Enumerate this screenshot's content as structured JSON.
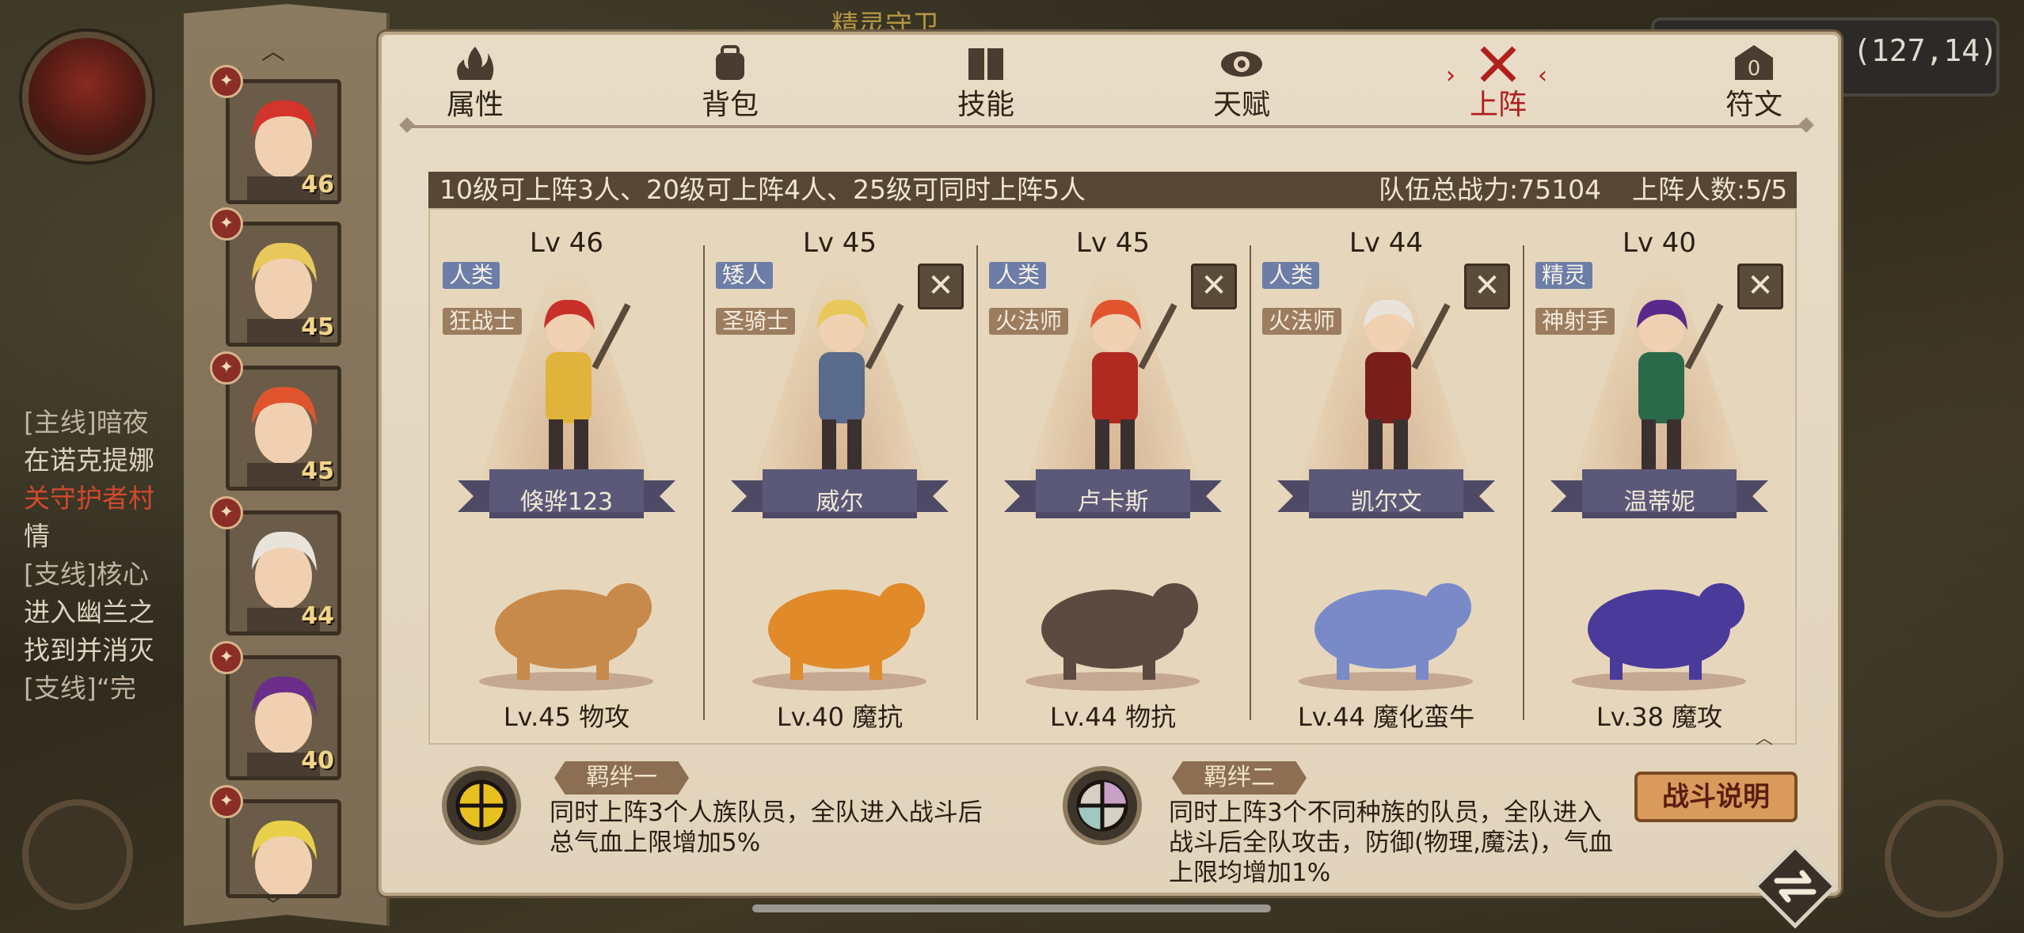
{
  "world": {
    "top_title": "精灵守卫",
    "coordinates": "(127,14)"
  },
  "quest_log": {
    "lines": [
      {
        "text": "[主线]暗夜",
        "style": "hdr"
      },
      {
        "text": "在诺克提娜",
        "style": ""
      },
      {
        "text": "关守护者村",
        "style": "red"
      },
      {
        "text": "情",
        "style": ""
      },
      {
        "text": "[支线]核心",
        "style": "hdr"
      },
      {
        "text": "进入幽兰之",
        "style": ""
      },
      {
        "text": "找到并消灭",
        "style": ""
      },
      {
        "text": "[支线]“完",
        "style": "hdr"
      }
    ]
  },
  "roster": [
    {
      "level": "46",
      "hair": "#d4352a"
    },
    {
      "level": "45",
      "hair": "#e8c85a"
    },
    {
      "level": "45",
      "hair": "#e0552e"
    },
    {
      "level": "44",
      "hair": "#e8e4dc"
    },
    {
      "level": "40",
      "hair": "#6a2e8a"
    },
    {
      "level": "",
      "hair": "#e8d04a"
    }
  ],
  "tabs": [
    {
      "label": "属性",
      "icon": "flame-icon",
      "active": false
    },
    {
      "label": "背包",
      "icon": "backpack-icon",
      "active": false
    },
    {
      "label": "技能",
      "icon": "book-icon",
      "active": false
    },
    {
      "label": "天赋",
      "icon": "eye-sigil-icon",
      "active": false
    },
    {
      "label": "上阵",
      "icon": "crossed-swords-icon",
      "active": true
    },
    {
      "label": "符文",
      "icon": "rune-icon",
      "active": false
    }
  ],
  "info": {
    "rule": "10级可上阵3人、20级可上阵4人、25级可同时上阵5人",
    "team_power": "队伍总战力:75104",
    "deploy_count": "上阵人数:5/5"
  },
  "team": [
    {
      "level": "Lv 46",
      "race": "人类",
      "class": "狂战士",
      "name": "倏骅123",
      "pet_label": "Lv.45 物攻",
      "removable": false,
      "hair": "#c8302a",
      "cloth": "#e0b43a",
      "pet": "#c88a4a"
    },
    {
      "level": "Lv 45",
      "race": "矮人",
      "class": "圣骑士",
      "name": "威尔",
      "pet_label": "Lv.40 魔抗",
      "removable": true,
      "hair": "#e8c85a",
      "cloth": "#5a6a8a",
      "pet": "#e08a2a"
    },
    {
      "level": "Lv 45",
      "race": "人类",
      "class": "火法师",
      "name": "卢卡斯",
      "pet_label": "Lv.44 物抗",
      "removable": true,
      "hair": "#e0552e",
      "cloth": "#b02a22",
      "pet": "#5a4a40"
    },
    {
      "level": "Lv 44",
      "race": "人类",
      "class": "火法师",
      "name": "凯尔文",
      "pet_label": "Lv.44 魔化蛮牛",
      "removable": true,
      "hair": "#e8e4dc",
      "cloth": "#7a1e1a",
      "pet": "#7a8ac8"
    },
    {
      "level": "Lv 40",
      "race": "精灵",
      "class": "神射手",
      "name": "温蒂妮",
      "pet_label": "Lv.38 魔攻",
      "removable": true,
      "hair": "#5a2a8a",
      "cloth": "#2a6a4a",
      "pet": "#4a3a9a"
    }
  ],
  "bonds": [
    {
      "title": "羁绊一",
      "lines": [
        "同时上阵3个人族队员，全队进入战斗后",
        "总气血上限增加5%"
      ]
    },
    {
      "title": "羁绊二",
      "lines": [
        "同时上阵3个不同种族的队员，全队进入",
        "战斗后全队攻击，防御(物理,魔法)，气血",
        "上限均增加1%"
      ]
    }
  ],
  "battle_button": "战斗说明",
  "colors": {
    "panel": "#e6d7bc",
    "info_bar": "#574636",
    "active_tab": "#b01e1e",
    "race_tag": "#6c7ea8",
    "class_tag": "#9c7d60"
  }
}
